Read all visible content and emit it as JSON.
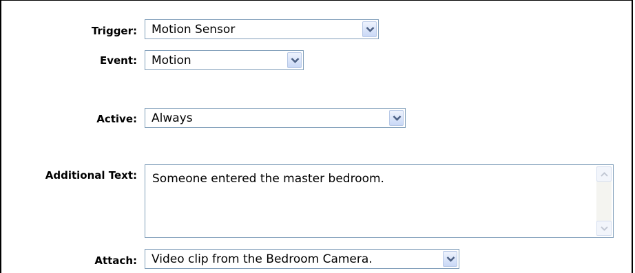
{
  "form": {
    "trigger": {
      "label": "Trigger:",
      "value": "Motion Sensor"
    },
    "event": {
      "label": "Event:",
      "value": "Motion"
    },
    "active": {
      "label": "Active:",
      "value": "Always"
    },
    "additional_text": {
      "label": "Additional Text:",
      "value": "Someone entered the master bedroom."
    },
    "attach": {
      "label": "Attach:",
      "value": "Video clip from the Bedroom Camera."
    }
  },
  "icons": {
    "dropdown": "chevron-down-icon",
    "scroll_up": "chevron-up-icon",
    "scroll_down": "chevron-down-icon"
  },
  "colors": {
    "field_border": "#7f9db9",
    "dropdown_button": "#c9d8f6",
    "chevron": "#4d6185"
  }
}
